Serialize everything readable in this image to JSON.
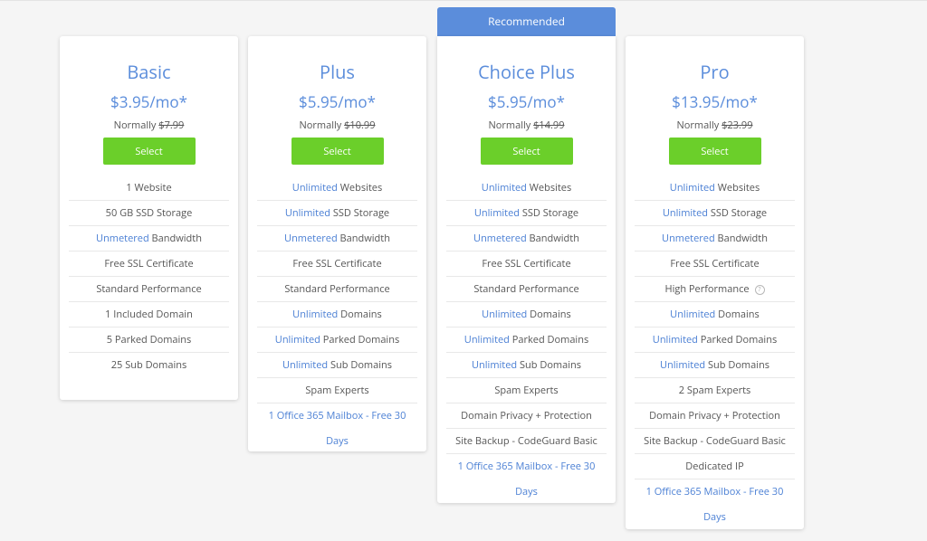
{
  "recommended_label": "Recommended",
  "plans": [
    {
      "name": "Basic",
      "price": "$3.95/mo*",
      "normally_label": "Normally",
      "normally_price": "$7.99",
      "select_label": "Select",
      "features": [
        {
          "hl": "",
          "text": "1 Website"
        },
        {
          "hl": "",
          "text": "50 GB SSD Storage"
        },
        {
          "hl": "Unmetered",
          "text": " Bandwidth"
        },
        {
          "hl": "",
          "text": "Free SSL Certificate"
        },
        {
          "hl": "",
          "text": "Standard Performance"
        },
        {
          "hl": "",
          "text": "1 Included Domain"
        },
        {
          "hl": "",
          "text": "5 Parked Domains"
        },
        {
          "hl": "",
          "text": "25 Sub Domains"
        }
      ]
    },
    {
      "name": "Plus",
      "price": "$5.95/mo*",
      "normally_label": "Normally",
      "normally_price": "$10.99",
      "select_label": "Select",
      "features": [
        {
          "hl": "Unlimited",
          "text": " Websites"
        },
        {
          "hl": "Unlimited",
          "text": " SSD Storage"
        },
        {
          "hl": "Unmetered",
          "text": " Bandwidth"
        },
        {
          "hl": "",
          "text": "Free SSL Certificate"
        },
        {
          "hl": "",
          "text": "Standard Performance"
        },
        {
          "hl": "Unlimited",
          "text": " Domains"
        },
        {
          "hl": "Unlimited",
          "text": " Parked Domains"
        },
        {
          "hl": "Unlimited",
          "text": " Sub Domains"
        },
        {
          "hl": "",
          "text": "Spam Experts"
        },
        {
          "link": "1 Office 365 Mailbox - Free 30 Days"
        }
      ]
    },
    {
      "name": "Choice Plus",
      "price": "$5.95/mo*",
      "normally_label": "Normally",
      "normally_price": "$14.99",
      "select_label": "Select",
      "features": [
        {
          "hl": "Unlimited",
          "text": " Websites"
        },
        {
          "hl": "Unlimited",
          "text": " SSD Storage"
        },
        {
          "hl": "Unmetered",
          "text": " Bandwidth"
        },
        {
          "hl": "",
          "text": "Free SSL Certificate"
        },
        {
          "hl": "",
          "text": "Standard Performance"
        },
        {
          "hl": "Unlimited",
          "text": " Domains"
        },
        {
          "hl": "Unlimited",
          "text": " Parked Domains"
        },
        {
          "hl": "Unlimited",
          "text": " Sub Domains"
        },
        {
          "hl": "",
          "text": "Spam Experts"
        },
        {
          "hl": "",
          "text": "Domain Privacy + Protection"
        },
        {
          "hl": "",
          "text": "Site Backup - CodeGuard Basic"
        },
        {
          "link": "1 Office 365 Mailbox - Free 30 Days"
        }
      ]
    },
    {
      "name": "Pro",
      "price": "$13.95/mo*",
      "normally_label": "Normally",
      "normally_price": "$23.99",
      "select_label": "Select",
      "features": [
        {
          "hl": "Unlimited",
          "text": " Websites"
        },
        {
          "hl": "Unlimited",
          "text": " SSD Storage"
        },
        {
          "hl": "Unmetered",
          "text": " Bandwidth"
        },
        {
          "hl": "",
          "text": "Free SSL Certificate"
        },
        {
          "hl": "",
          "text": "High Performance",
          "info": "?"
        },
        {
          "hl": "Unlimited",
          "text": " Domains"
        },
        {
          "hl": "Unlimited",
          "text": " Parked Domains"
        },
        {
          "hl": "Unlimited",
          "text": " Sub Domains"
        },
        {
          "hl": "",
          "text": "2 Spam Experts"
        },
        {
          "hl": "",
          "text": "Domain Privacy + Protection"
        },
        {
          "hl": "",
          "text": "Site Backup - CodeGuard Basic"
        },
        {
          "hl": "",
          "text": "Dedicated IP"
        },
        {
          "link": "1 Office 365 Mailbox - Free 30 Days"
        }
      ]
    }
  ]
}
